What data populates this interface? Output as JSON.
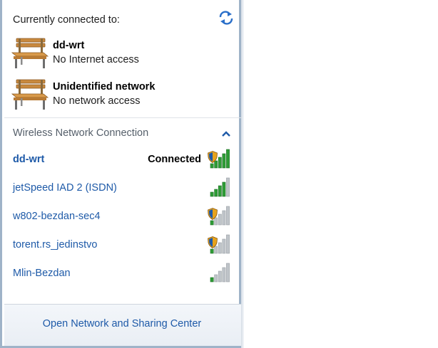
{
  "header": {
    "title": "Currently connected to:",
    "refresh_icon": "refresh-arrows-icon"
  },
  "connections": [
    {
      "name": "dd-wrt",
      "status": "No Internet access",
      "icon": "bench-icon"
    },
    {
      "name": "Unidentified network",
      "status": "No network access",
      "icon": "bench-icon"
    }
  ],
  "wireless": {
    "title": "Wireless Network Connection",
    "collapse_icon": "chevron-up-icon",
    "networks": [
      {
        "ssid": "dd-wrt",
        "state": "Connected",
        "secured": true,
        "signal": 5,
        "connected": true
      },
      {
        "ssid": "jetSpeed IAD 2 (ISDN)",
        "state": "",
        "secured": false,
        "signal": 4,
        "connected": false
      },
      {
        "ssid": "w802-bezdan-sec4",
        "state": "",
        "secured": true,
        "signal": 1,
        "connected": false
      },
      {
        "ssid": "torent.rs_jedinstvo",
        "state": "",
        "secured": true,
        "signal": 1,
        "connected": false
      },
      {
        "ssid": "Mlin-Bezdan",
        "state": "",
        "secured": false,
        "signal": 1,
        "connected": false
      }
    ]
  },
  "footer": {
    "link_label": "Open Network and Sharing Center"
  },
  "colors": {
    "link": "#1e5aa8",
    "signal_green": "#2e9c36",
    "signal_gray": "#bfc4c9",
    "shield": "#e6a21c"
  }
}
